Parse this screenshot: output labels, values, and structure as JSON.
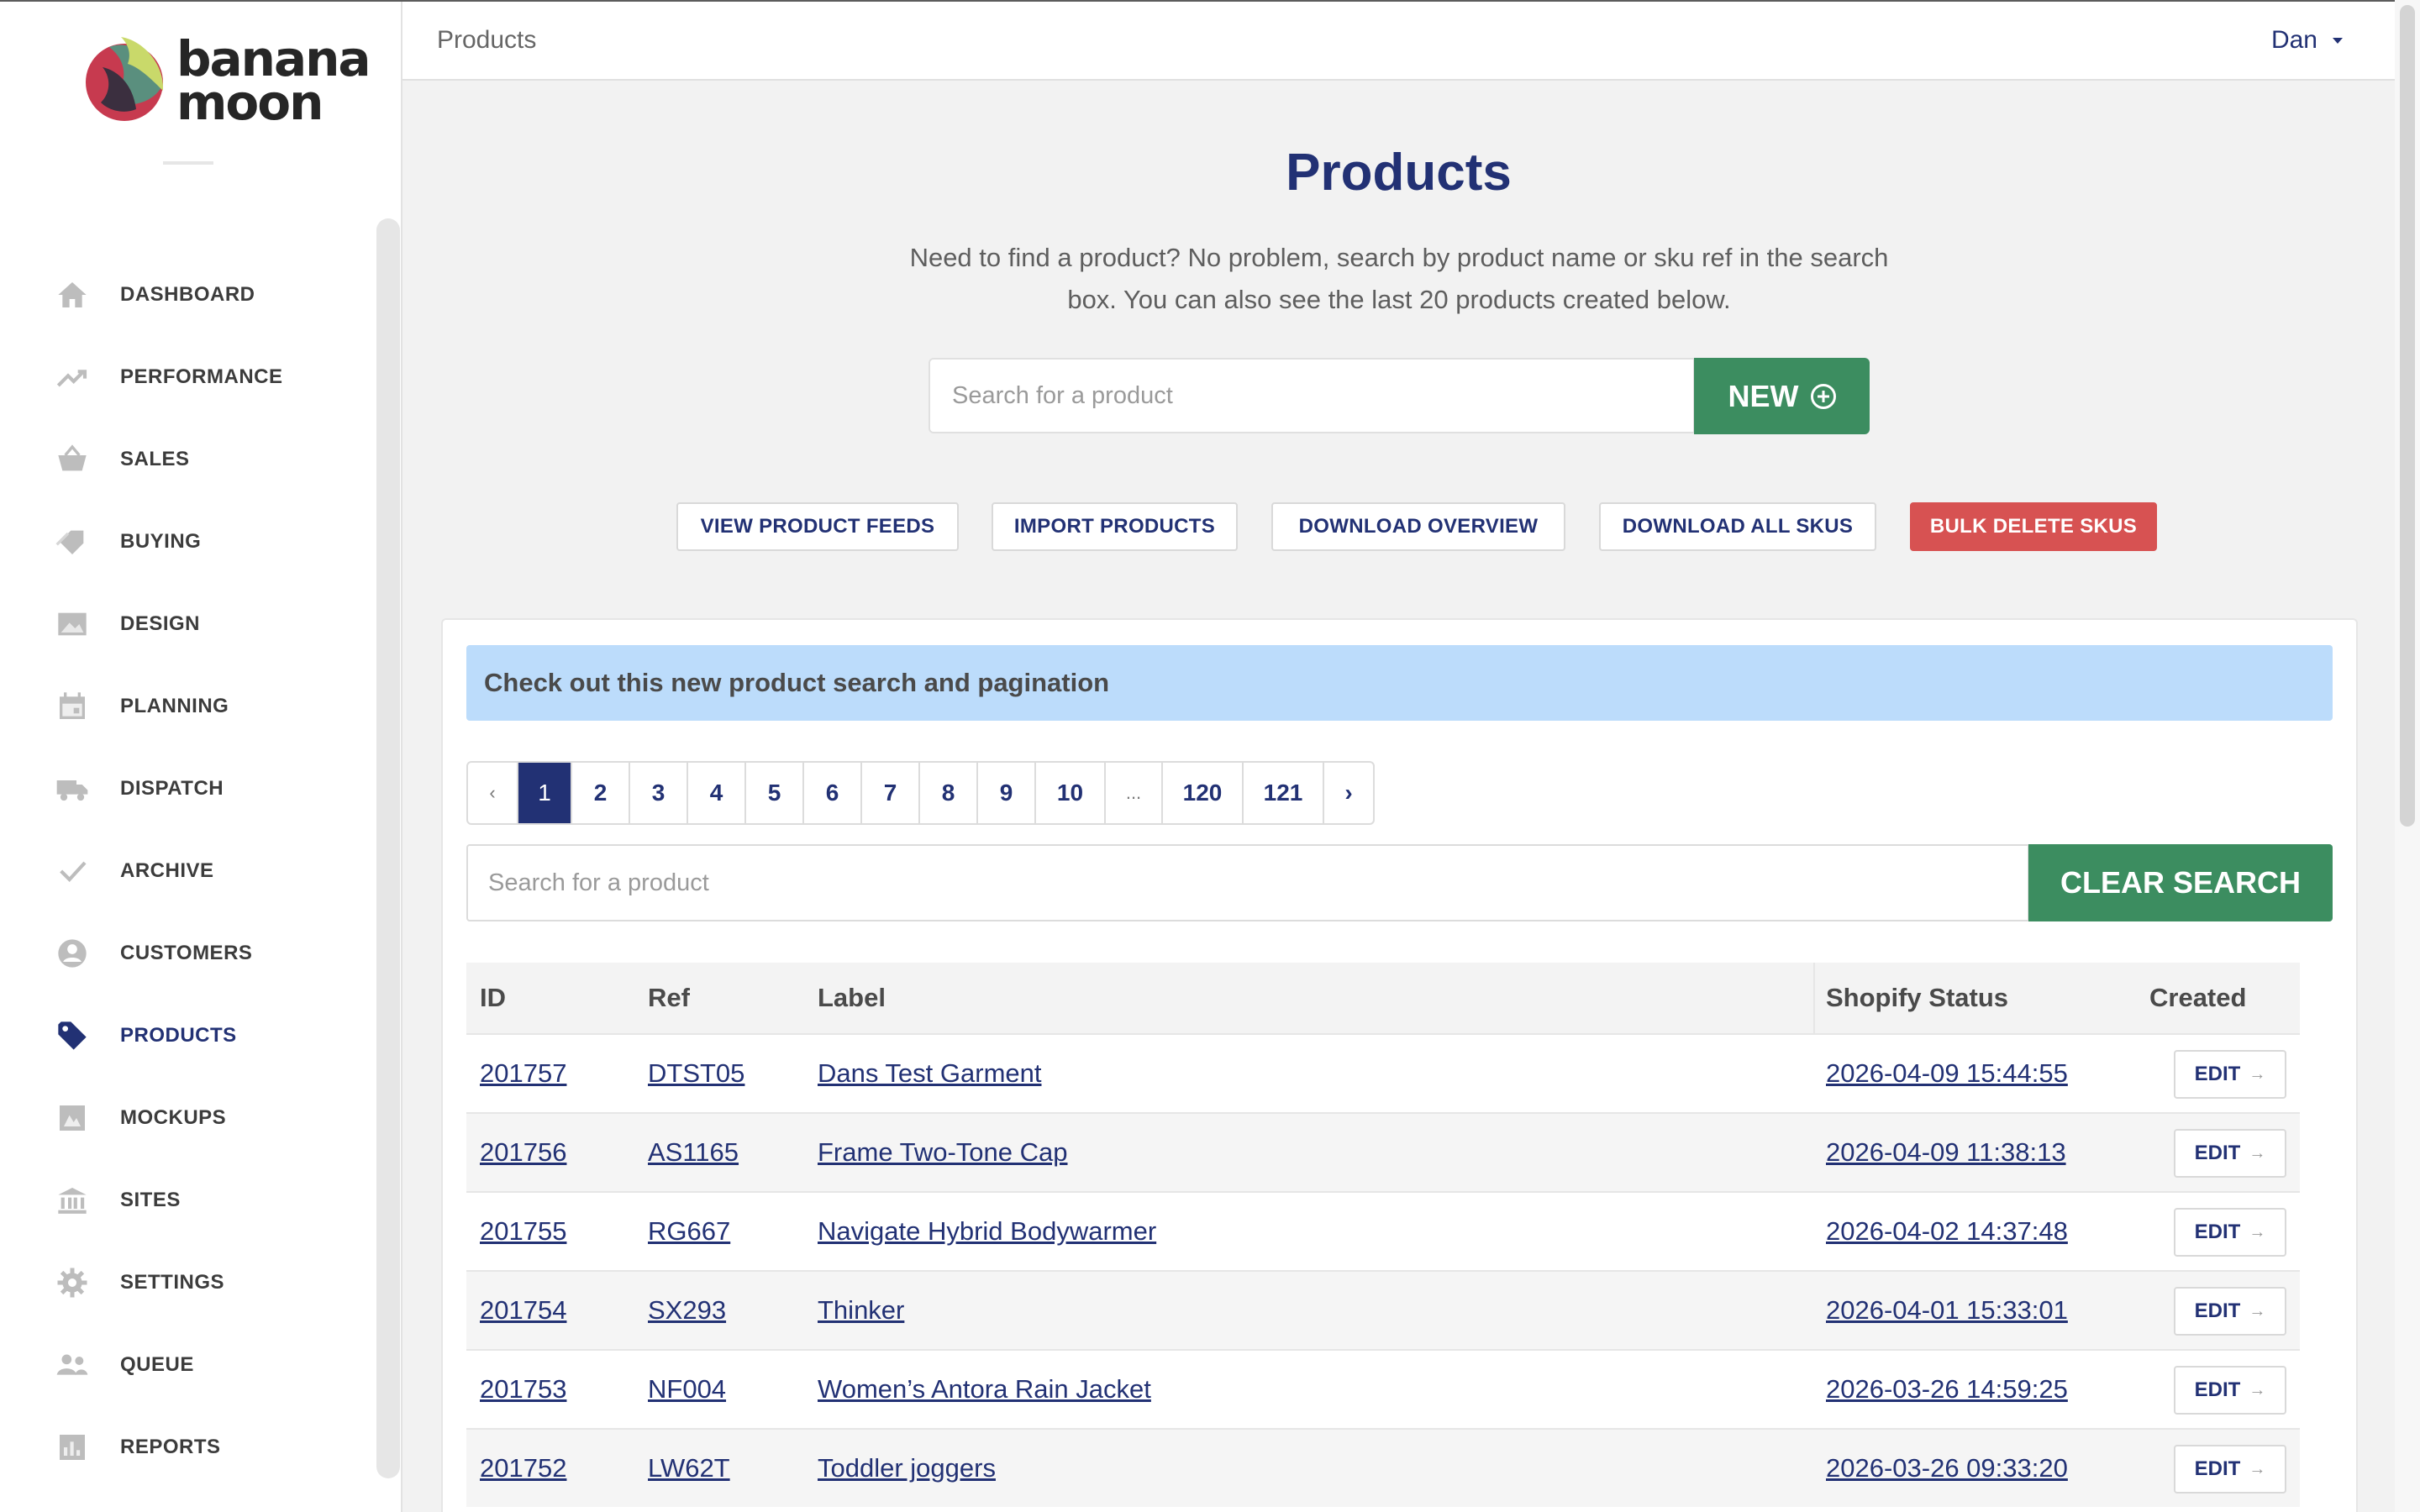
{
  "brand": {
    "logo_line1": "banana",
    "logo_line2": "moon"
  },
  "sidebar": {
    "items": [
      {
        "label": "DASHBOARD",
        "icon": "home-icon"
      },
      {
        "label": "PERFORMANCE",
        "icon": "trend-icon"
      },
      {
        "label": "SALES",
        "icon": "basket-icon"
      },
      {
        "label": "BUYING",
        "icon": "tags-icon"
      },
      {
        "label": "DESIGN",
        "icon": "image-icon"
      },
      {
        "label": "PLANNING",
        "icon": "calendar-icon"
      },
      {
        "label": "DISPATCH",
        "icon": "truck-icon"
      },
      {
        "label": "ARCHIVE",
        "icon": "check-icon"
      },
      {
        "label": "CUSTOMERS",
        "icon": "user-circle-icon"
      },
      {
        "label": "PRODUCTS",
        "icon": "tag-icon",
        "active": true
      },
      {
        "label": "MOCKUPS",
        "icon": "mockup-icon"
      },
      {
        "label": "SITES",
        "icon": "bank-icon"
      },
      {
        "label": "SETTINGS",
        "icon": "gear-icon"
      },
      {
        "label": "QUEUE",
        "icon": "people-icon"
      },
      {
        "label": "REPORTS",
        "icon": "bar-chart-icon"
      }
    ]
  },
  "topbar": {
    "breadcrumb": "Products",
    "user": "Dan"
  },
  "page": {
    "title": "Products",
    "intro": "Need to find a product? No problem, search by product name or sku ref in the search box. You can also see the last 20 products created below.",
    "search_placeholder": "Search for a product",
    "new_label": "NEW"
  },
  "actions": {
    "view_feeds": "VIEW PRODUCT FEEDS",
    "import": "IMPORT PRODUCTS",
    "download_overview": "DOWNLOAD OVERVIEW",
    "download_skus": "DOWNLOAD ALL SKUS",
    "bulk_delete": "BULK DELETE SKUS"
  },
  "notice": "Check out this new product search and pagination",
  "pagination": {
    "prev": "‹",
    "pages": [
      "1",
      "2",
      "3",
      "4",
      "5",
      "6",
      "7",
      "8",
      "9",
      "10",
      "...",
      "120",
      "121"
    ],
    "next": "›",
    "current": "1"
  },
  "list_search": {
    "placeholder": "Search for a product",
    "clear_label": "CLEAR SEARCH"
  },
  "table": {
    "headers": {
      "id": "ID",
      "ref": "Ref",
      "label": "Label",
      "status": "Shopify Status",
      "created": "Created"
    },
    "edit_label": "EDIT",
    "rows": [
      {
        "id": "201757",
        "ref": "DTST05",
        "label": "Dans Test Garment",
        "created": "2026-04-09 15:44:55"
      },
      {
        "id": "201756",
        "ref": "AS1165",
        "label": "Frame Two-Tone Cap",
        "created": "2026-04-09 11:38:13"
      },
      {
        "id": "201755",
        "ref": "RG667",
        "label": "Navigate Hybrid Bodywarmer",
        "created": "2026-04-02 14:37:48"
      },
      {
        "id": "201754",
        "ref": "SX293",
        "label": "Thinker",
        "created": "2026-04-01 15:33:01"
      },
      {
        "id": "201753",
        "ref": "NF004",
        "label": "Women’s Antora Rain Jacket",
        "created": "2026-03-26 14:59:25"
      },
      {
        "id": "201752",
        "ref": "LW62T",
        "label": "Toddler joggers",
        "created": "2026-03-26 09:33:20"
      }
    ]
  },
  "colors": {
    "brand_navy": "#223174",
    "success_green": "#3c8d60",
    "danger_red": "#d75252",
    "notice_blue": "#bcdcfb"
  }
}
